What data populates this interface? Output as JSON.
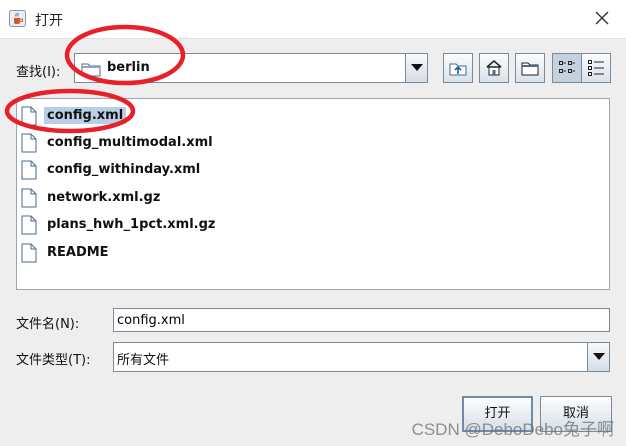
{
  "window": {
    "title": "打开",
    "icons": {
      "app": "java-cup-icon",
      "close": "close-icon"
    }
  },
  "toolbar": {
    "look_in_label": "查找(I):",
    "look_in_value": "berlin",
    "buttons": [
      "up-one-level-icon",
      "home-icon",
      "new-folder-icon",
      "list-view-icon",
      "details-view-icon"
    ]
  },
  "files": [
    {
      "name": "config.xml",
      "selected": true
    },
    {
      "name": "config_multimodal.xml",
      "selected": false
    },
    {
      "name": "config_withinday.xml",
      "selected": false
    },
    {
      "name": "network.xml.gz",
      "selected": false
    },
    {
      "name": "plans_hwh_1pct.xml.gz",
      "selected": false
    },
    {
      "name": "README",
      "selected": false
    }
  ],
  "filename": {
    "label": "文件名(N):",
    "value": "config.xml"
  },
  "filetype": {
    "label": "文件类型(T):",
    "value": "所有文件"
  },
  "buttons": {
    "open": "打开",
    "cancel": "取消"
  },
  "watermark": "CSDN @DeboDebo兔子啊",
  "colors": {
    "selection": "#b8cfe5",
    "annotation": "#e8202a"
  }
}
